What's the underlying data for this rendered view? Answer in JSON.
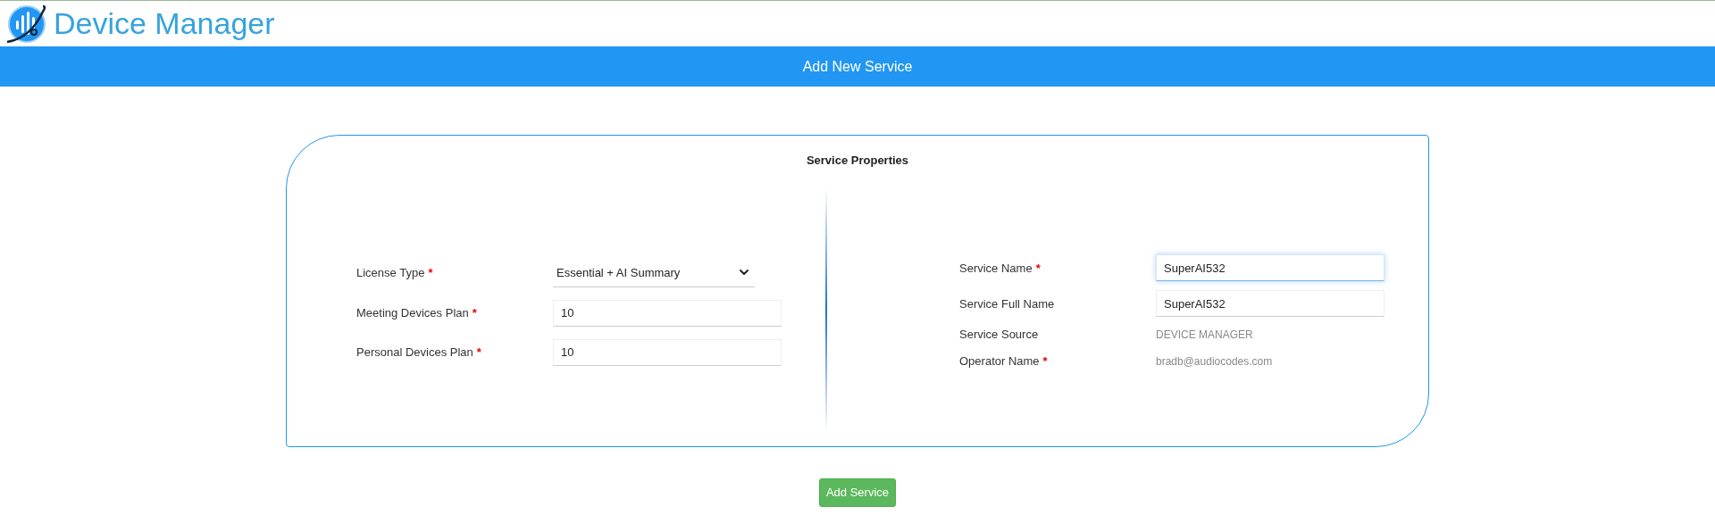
{
  "header": {
    "title": "Device Manager"
  },
  "banner": {
    "title": "Add New Service"
  },
  "card": {
    "title": "Service Properties",
    "left_fields": [
      {
        "kind": "select",
        "label": "License Type",
        "required_mark": "*",
        "value": "Essential + AI Summary"
      },
      {
        "kind": "input",
        "label": "Meeting Devices Plan",
        "required_mark": "*",
        "value": "10",
        "focused": false
      },
      {
        "kind": "input",
        "label": "Personal Devices Plan",
        "required_mark": "*",
        "value": "10",
        "focused": false
      }
    ],
    "right_fields": [
      {
        "kind": "input",
        "label": "Service Name",
        "required_mark": "*",
        "value": "SuperAI532",
        "focused": true
      },
      {
        "kind": "input",
        "label": "Service Full Name",
        "value": "SuperAI532",
        "focused": false
      },
      {
        "kind": "static",
        "label": "Service Source",
        "value": "DEVICE MANAGER"
      },
      {
        "kind": "static",
        "label": "Operator Name",
        "required_mark": "*",
        "value": "bradb@audiocodes.com"
      }
    ]
  },
  "submit": {
    "label": "Add Service"
  }
}
